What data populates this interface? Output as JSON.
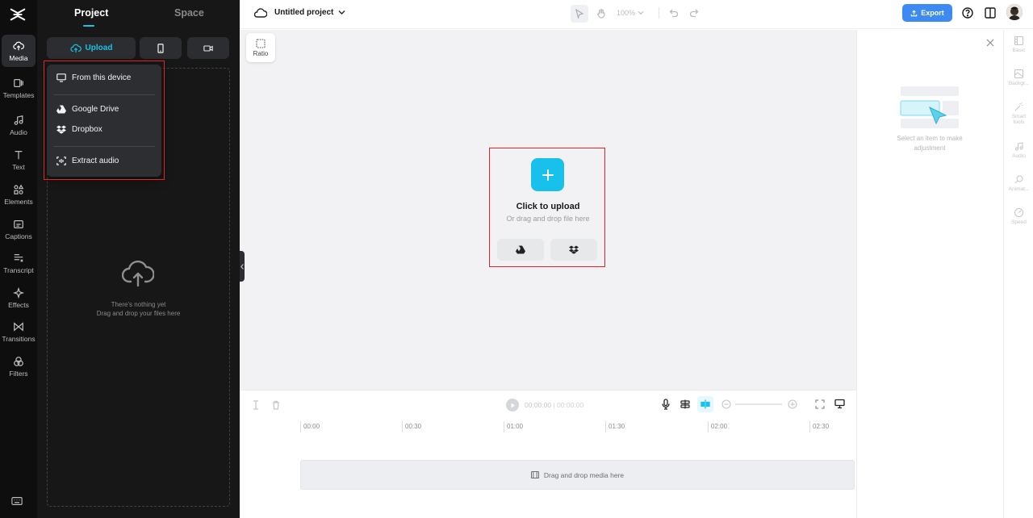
{
  "left_rail": {
    "items": [
      {
        "label": "Media"
      },
      {
        "label": "Templates"
      },
      {
        "label": "Audio"
      },
      {
        "label": "Text"
      },
      {
        "label": "Elements"
      },
      {
        "label": "Captions"
      },
      {
        "label": "Transcript"
      },
      {
        "label": "Effects"
      },
      {
        "label": "Transitions"
      },
      {
        "label": "Filters"
      }
    ]
  },
  "media_panel": {
    "tabs": [
      {
        "label": "Project"
      },
      {
        "label": "Space"
      }
    ],
    "upload_label": "Upload",
    "empty_line1": "There's nothing yet",
    "empty_line2": "Drag and drop your files here",
    "dropdown": [
      {
        "label": "From this device"
      },
      {
        "label": "Google Drive"
      },
      {
        "label": "Dropbox"
      },
      {
        "label": "Extract audio"
      }
    ]
  },
  "topbar": {
    "project_title": "Untitled project",
    "zoom": "100%",
    "export_label": "Export"
  },
  "canvas": {
    "ratio_label": "Ratio",
    "upload_title": "Click to upload",
    "upload_subtitle": "Or drag and drop file here"
  },
  "timeline": {
    "current_time": "00:00:00",
    "total_time": "00:00:00",
    "ruler_ticks": [
      "00:00",
      "00:30",
      "01:00",
      "01:30",
      "02:00",
      "02:30"
    ],
    "drop_text": "Drag and drop media here"
  },
  "props_panel": {
    "empty_text": "Select an item to make adjustment"
  },
  "right_rail": {
    "items": [
      {
        "label": "Basic"
      },
      {
        "label": "Backgr..."
      },
      {
        "label": "Smart tools"
      },
      {
        "label": "Audio"
      },
      {
        "label": "Animat..."
      },
      {
        "label": "Speed"
      }
    ]
  },
  "colors": {
    "accent": "#18c0ec",
    "export": "#3d8bf2",
    "highlight": "#e5222a",
    "panel_bg": "#171717"
  }
}
